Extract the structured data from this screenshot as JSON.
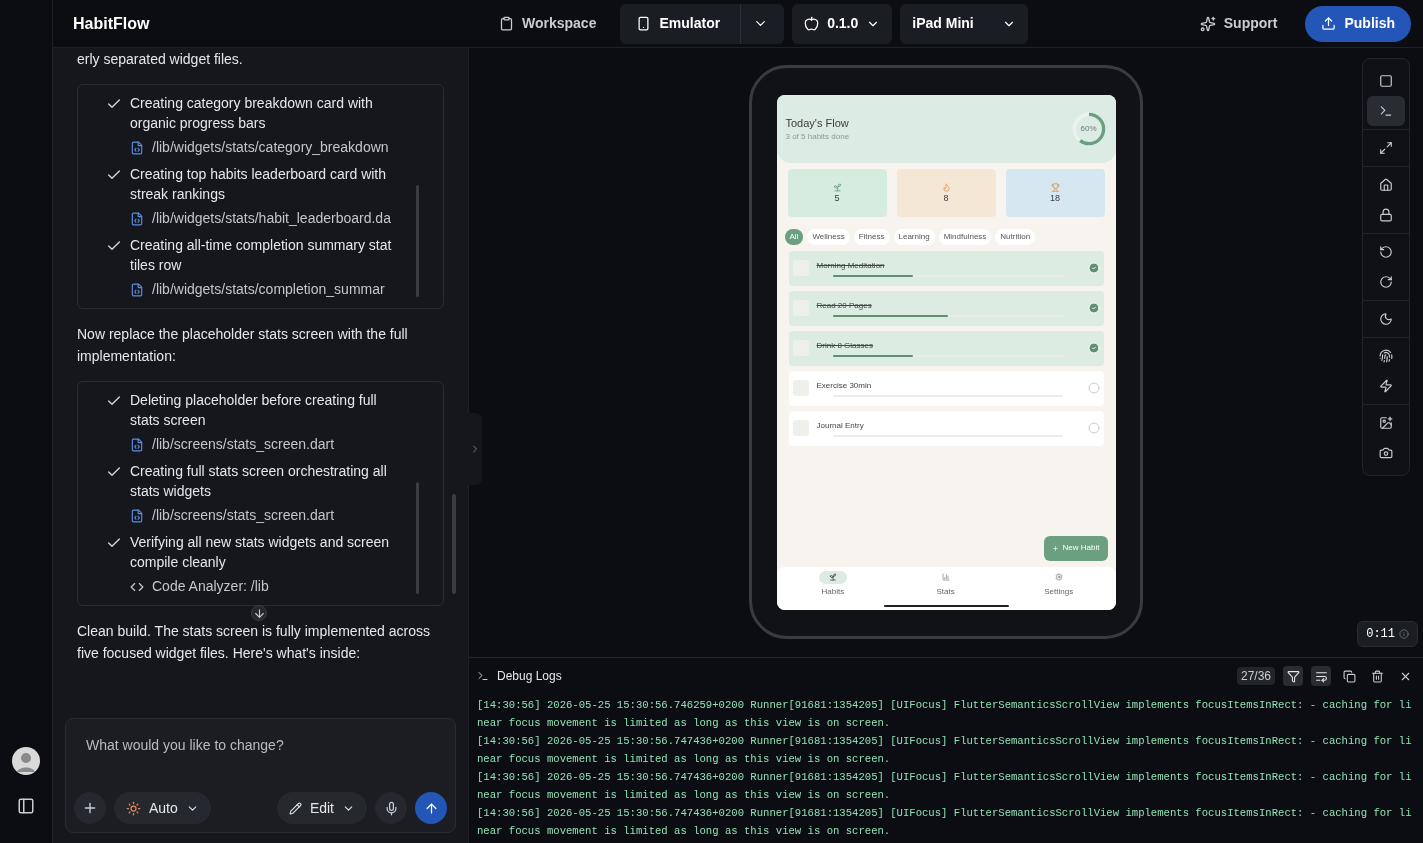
{
  "app": {
    "name": "HabitFlow"
  },
  "header": {
    "tabs": [
      {
        "label": "Workspace",
        "selected": false,
        "kind": "workspace"
      },
      {
        "label": "Emulator",
        "selected": true,
        "kind": "emulator"
      }
    ],
    "version": "0.1.0",
    "device": "iPad Mini",
    "support": "Support",
    "publish": "Publish"
  },
  "chat": {
    "items": [
      {
        "kind": "text",
        "text": "erly separated widget files."
      },
      {
        "kind": "steps",
        "steps": [
          {
            "text": "Creating category breakdown card with organic progress bars",
            "kind": "file",
            "ref": "/lib/widgets/stats/category_breakdown"
          },
          {
            "text": "Creating top habits leaderboard card with streak rankings",
            "kind": "file",
            "ref": "/lib/widgets/stats/habit_leaderboard.da"
          },
          {
            "text": "Creating all-time completion summary stat tiles row",
            "kind": "file",
            "ref": "/lib/widgets/stats/completion_summar"
          }
        ]
      },
      {
        "kind": "text",
        "text": "Now replace the placeholder stats screen with the full implementation:"
      },
      {
        "kind": "steps",
        "steps": [
          {
            "text": "Deleting placeholder before creating full stats screen",
            "kind": "file",
            "ref": "/lib/screens/stats_screen.dart"
          },
          {
            "text": "Creating full stats screen orchestrating all stats widgets",
            "kind": "file",
            "ref": "/lib/screens/stats_screen.dart"
          },
          {
            "text": "Verifying all new stats widgets and screen compile cleanly",
            "kind": "tool",
            "ref": "Code Analyzer: /lib"
          }
        ]
      },
      {
        "kind": "text",
        "text": "Clean build. The stats screen is fully implemented across five focused widget files. Here's what's inside:"
      }
    ],
    "input": {
      "placeholder": "What would you like to change?"
    },
    "mode": "Auto",
    "edit": "Edit"
  },
  "emulator": {
    "tool_groups": [
      [
        {
          "kind": "window",
          "selected": false
        },
        {
          "kind": "terminal",
          "selected": true
        }
      ],
      [
        {
          "kind": "expand",
          "selected": false
        }
      ],
      [
        {
          "kind": "home",
          "selected": false
        },
        {
          "kind": "lock",
          "selected": false
        }
      ],
      [
        {
          "kind": "rotate-left",
          "selected": false
        },
        {
          "kind": "rotate-right",
          "selected": false
        }
      ],
      [
        {
          "kind": "moon",
          "selected": false
        }
      ],
      [
        {
          "kind": "fingerprint",
          "selected": false
        },
        {
          "kind": "flash",
          "selected": false
        }
      ],
      [
        {
          "kind": "image",
          "selected": false
        },
        {
          "kind": "camera",
          "selected": false
        }
      ]
    ],
    "timer": "0:11",
    "screen": {
      "title": "Today's Flow",
      "subtitle": "3 of 5 habits done",
      "progress": {
        "label": "60%",
        "level": 0.6
      },
      "stats": [
        {
          "kind": "sprout",
          "value": "5",
          "color": "#d6ecdf"
        },
        {
          "kind": "flame",
          "value": "8",
          "color": "#f5e7d6"
        },
        {
          "kind": "trophy",
          "value": "18",
          "color": "#d7e7f2"
        }
      ],
      "chips": [
        {
          "label": "All",
          "selected": true
        },
        {
          "label": "Wellness",
          "selected": false
        },
        {
          "label": "Fitness",
          "selected": false
        },
        {
          "label": "Learning",
          "selected": false
        },
        {
          "label": "Mindfulness",
          "selected": false
        },
        {
          "label": "Nutrition",
          "selected": false
        }
      ],
      "habits": [
        {
          "name": "Morning Meditation",
          "done": true,
          "level": 0.35
        },
        {
          "name": "Read 20 Pages",
          "done": true,
          "level": 0.5
        },
        {
          "name": "Drink 8 Glasses",
          "done": true,
          "level": 0.35
        },
        {
          "name": "Exercise 30min",
          "done": false
        },
        {
          "name": "Journal Entry",
          "done": false
        }
      ],
      "fab": "New Habit",
      "nav": [
        {
          "label": "Habits",
          "selected": true,
          "kind": "sprout"
        },
        {
          "label": "Stats",
          "selected": false,
          "kind": "chart"
        },
        {
          "label": "Settings",
          "selected": false,
          "kind": "gear"
        }
      ]
    }
  },
  "logs": {
    "title": "Debug Logs",
    "count": "27/36",
    "filter_on": true,
    "wrap_on": true,
    "entries": [
      "[14:30:56] 2026-05-25 15:30:56.746259+0200 Runner[91681:1354205] [UIFocus] FlutterSemanticsScrollView implements focusItemsInRect: - caching for linear focus movement is limited as long as this view is on screen.",
      "[14:30:56] 2026-05-25 15:30:56.747436+0200 Runner[91681:1354205] [UIFocus] FlutterSemanticsScrollView implements focusItemsInRect: - caching for linear focus movement is limited as long as this view is on screen.",
      "[14:30:56] 2026-05-25 15:30:56.747436+0200 Runner[91681:1354205] [UIFocus] FlutterSemanticsScrollView implements focusItemsInRect: - caching for linear focus movement is limited as long as this view is on screen.",
      "[14:30:56] 2026-05-25 15:30:56.747436+0200 Runner[91681:1354205] [UIFocus] FlutterSemanticsScrollView implements focusItemsInRect: - caching for linear focus movement is limited as long as this view is on screen."
    ]
  }
}
